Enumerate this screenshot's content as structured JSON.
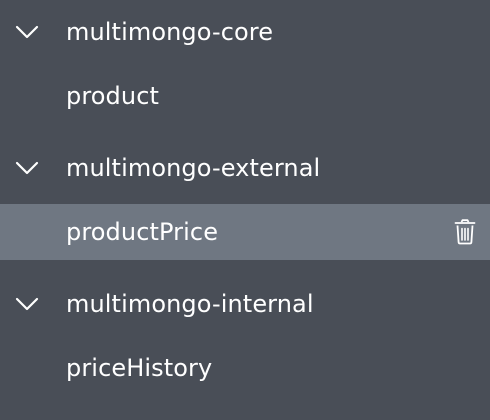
{
  "tree": {
    "databases": [
      {
        "name": "multimongo-core",
        "expanded": true,
        "collections": [
          {
            "name": "product",
            "selected": false
          }
        ]
      },
      {
        "name": "multimongo-external",
        "expanded": true,
        "collections": [
          {
            "name": "productPrice",
            "selected": true,
            "action_icon": "trash-icon"
          }
        ]
      },
      {
        "name": "multimongo-internal",
        "expanded": true,
        "collections": [
          {
            "name": "priceHistory",
            "selected": false
          }
        ]
      }
    ]
  },
  "colors": {
    "background": "#494e57",
    "selected_row": "#6f7782",
    "text": "#ffffff"
  }
}
